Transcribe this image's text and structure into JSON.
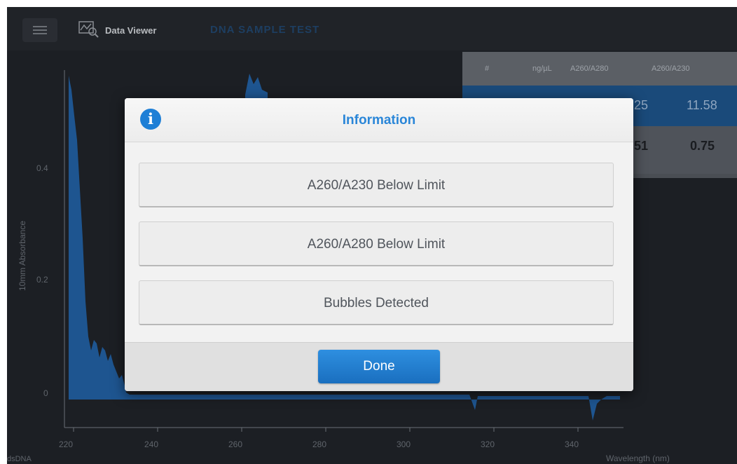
{
  "header": {
    "app_title": "Data Viewer",
    "experiment_name": "DNA SAMPLE TEST",
    "menu_icon": "hamburger-icon",
    "viewer_icon": "data-viewer-icon"
  },
  "plot": {
    "y_axis_label": "10mm Absorbance",
    "x_axis_label": "Wavelength (nm)",
    "sample_type": "dsDNA",
    "y_ticks": [
      "0.4",
      "0.2",
      "0"
    ],
    "x_ticks": [
      "220",
      "240",
      "260",
      "280",
      "300",
      "320",
      "340"
    ],
    "series_color": "#1f5fa3"
  },
  "results": {
    "columns": [
      "#",
      "ng/µL",
      "A260/A280",
      "A260/A230"
    ],
    "rows": [
      {
        "ratio_280": "25",
        "ratio_230": "11.58"
      },
      {
        "ratio_280": "51",
        "ratio_230": "0.75"
      }
    ]
  },
  "dialog": {
    "title": "Information",
    "icon": "info-icon",
    "messages": [
      "A260/A230 Below Limit",
      "A260/A280 Below Limit",
      "Bubbles Detected"
    ],
    "done_label": "Done"
  },
  "colors": {
    "accent": "#2a86d8",
    "done_button": "#1f7ccc",
    "overlay": "#1c1f24"
  }
}
